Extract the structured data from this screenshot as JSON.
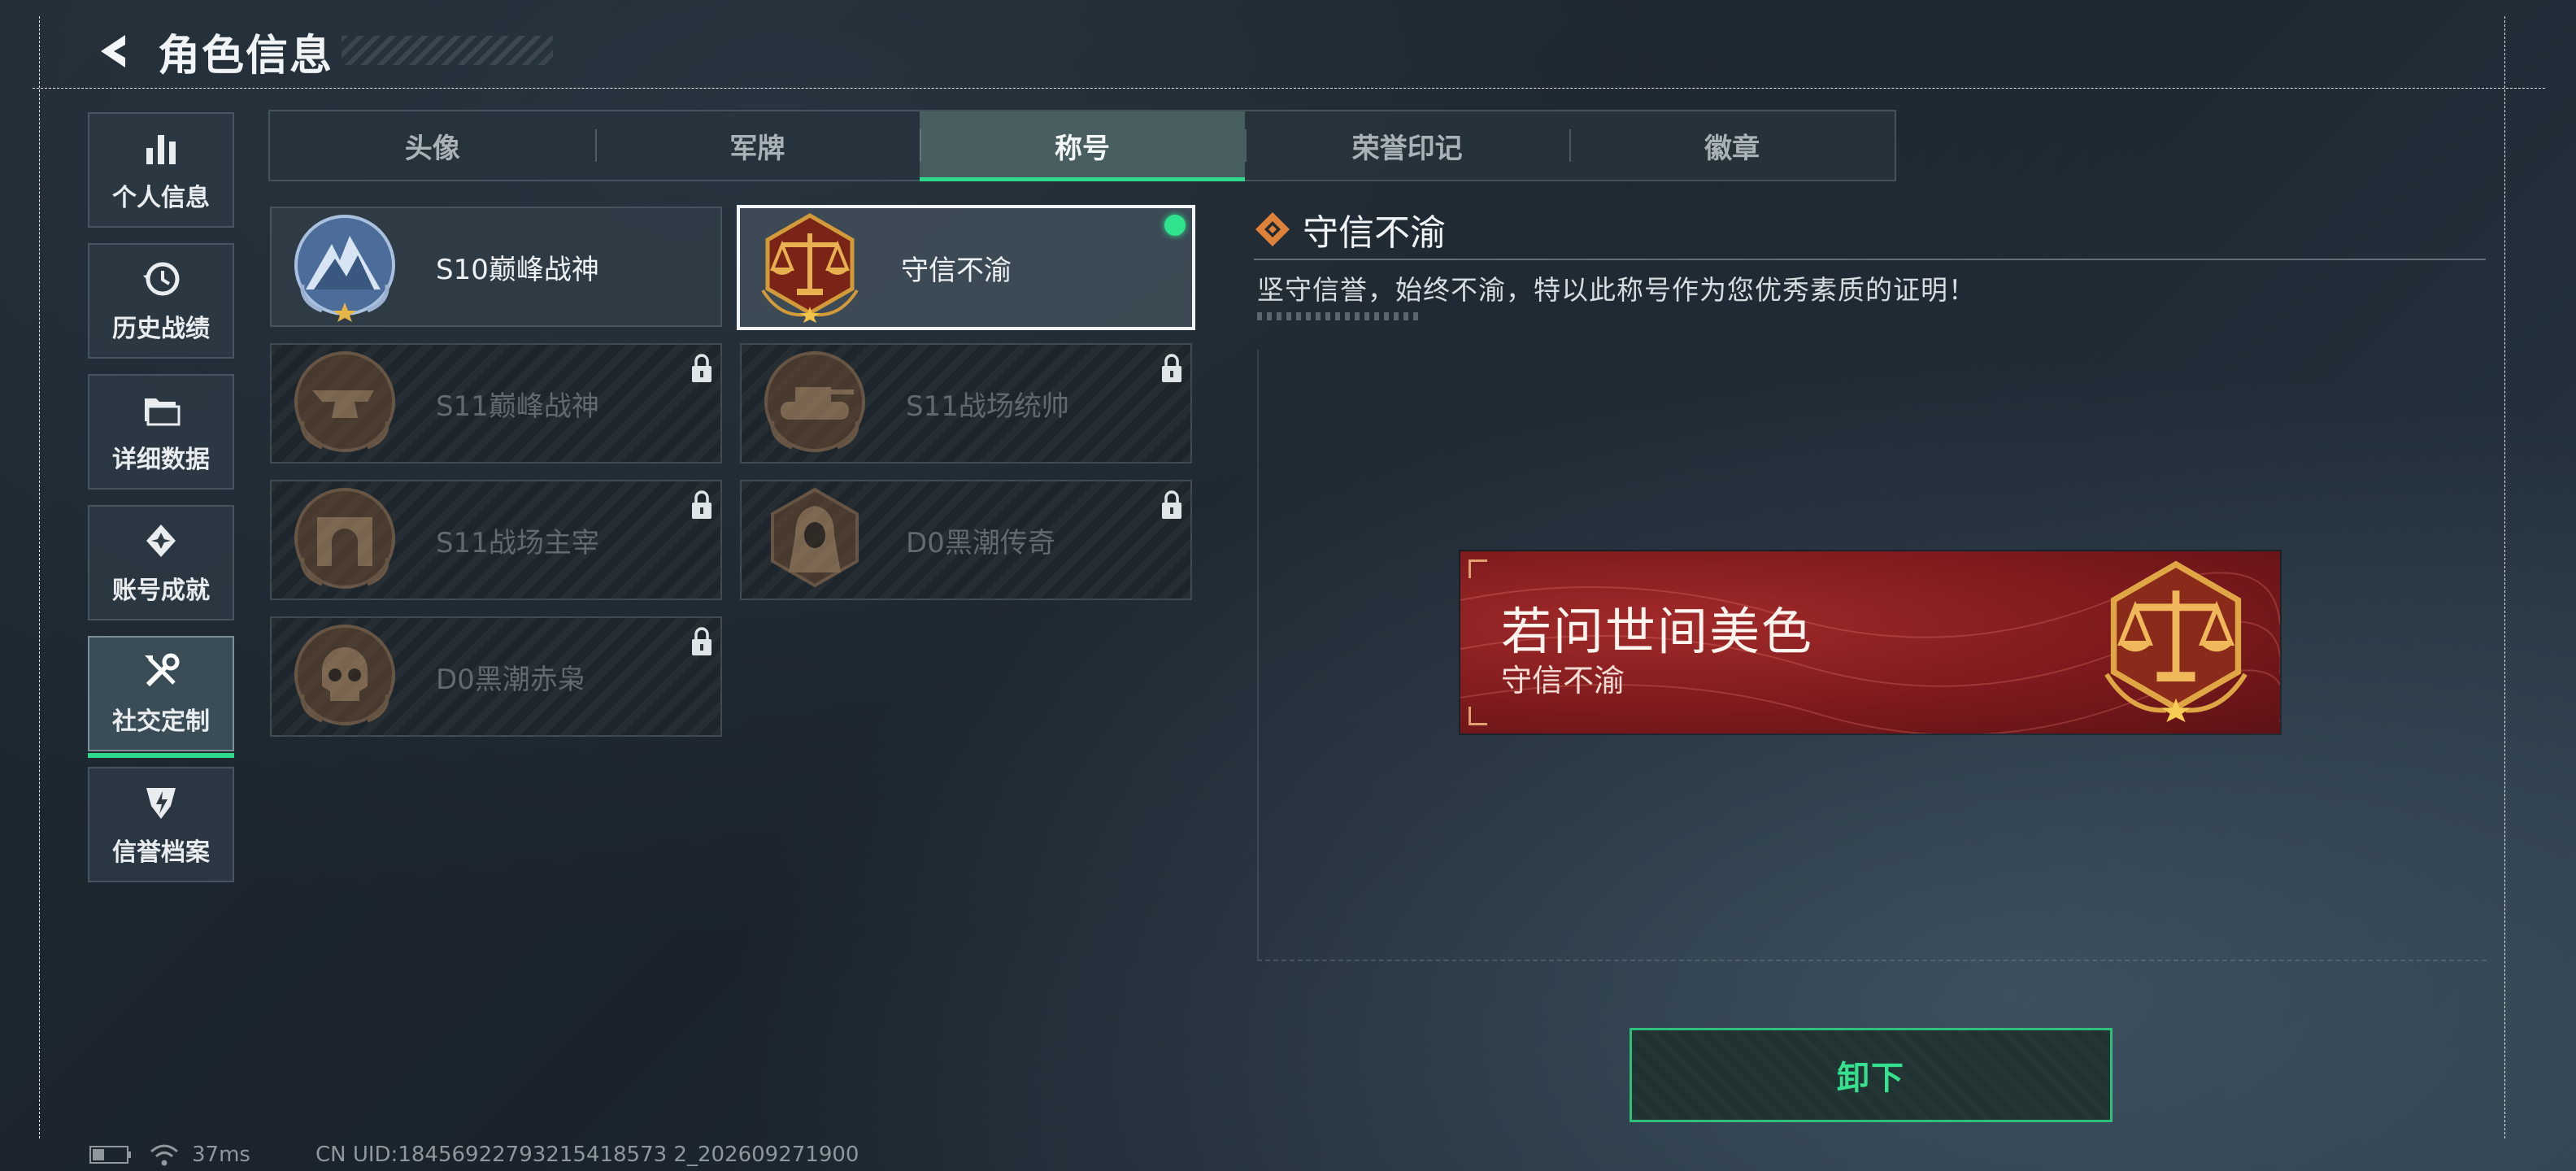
{
  "header": {
    "title": "角色信息",
    "back_icon": "back-arrow-icon"
  },
  "sidebar": {
    "items": [
      {
        "label": "个人信息",
        "icon": "bar-chart-icon",
        "active": false
      },
      {
        "label": "历史战绩",
        "icon": "clock-history-icon",
        "active": false
      },
      {
        "label": "详细数据",
        "icon": "folder-icon",
        "active": false
      },
      {
        "label": "账号成就",
        "icon": "achievement-icon",
        "active": false
      },
      {
        "label": "社交定制",
        "icon": "tools-icon",
        "active": true
      },
      {
        "label": "信誉档案",
        "icon": "shield-bolt-icon",
        "active": false
      }
    ]
  },
  "tabs": [
    {
      "label": "头像",
      "active": false
    },
    {
      "label": "军牌",
      "active": false
    },
    {
      "label": "称号",
      "active": true
    },
    {
      "label": "荣誉印记",
      "active": false
    },
    {
      "label": "徽章",
      "active": false
    }
  ],
  "titles": [
    {
      "label": "S10巅峰战神",
      "emblem": "peak-mountain-emblem-icon",
      "locked": false,
      "selected": false
    },
    {
      "label": "守信不渝",
      "emblem": "scales-of-justice-emblem-icon",
      "locked": false,
      "selected": true,
      "equipped": true
    },
    {
      "label": "S11巅峰战神",
      "emblem": "anvil-emblem-icon",
      "locked": true
    },
    {
      "label": "S11战场统帅",
      "emblem": "tank-emblem-icon",
      "locked": true
    },
    {
      "label": "S11战场主宰",
      "emblem": "arch-emblem-icon",
      "locked": true
    },
    {
      "label": "D0黑潮传奇",
      "emblem": "hooded-figure-emblem-icon",
      "locked": true
    },
    {
      "label": "D0黑潮赤枭",
      "emblem": "skull-emblem-icon",
      "locked": true
    }
  ],
  "detail": {
    "title": "守信不渝",
    "description": "坚守信誉，始终不渝，特以此称号作为您优秀素质的证明！",
    "banner": {
      "title": "若问世间美色",
      "subtitle": "守信不渝",
      "emblem": "scales-of-justice-emblem-icon"
    }
  },
  "actions": {
    "unequip_label": "卸下"
  },
  "status": {
    "ping": "37ms",
    "uid": "CN UID:18456922793215418573 2_202609271900"
  },
  "colors": {
    "accent_green": "#2fd98c",
    "banner_red": "#8b1f22",
    "emblem_gold": "#d39a3a"
  }
}
